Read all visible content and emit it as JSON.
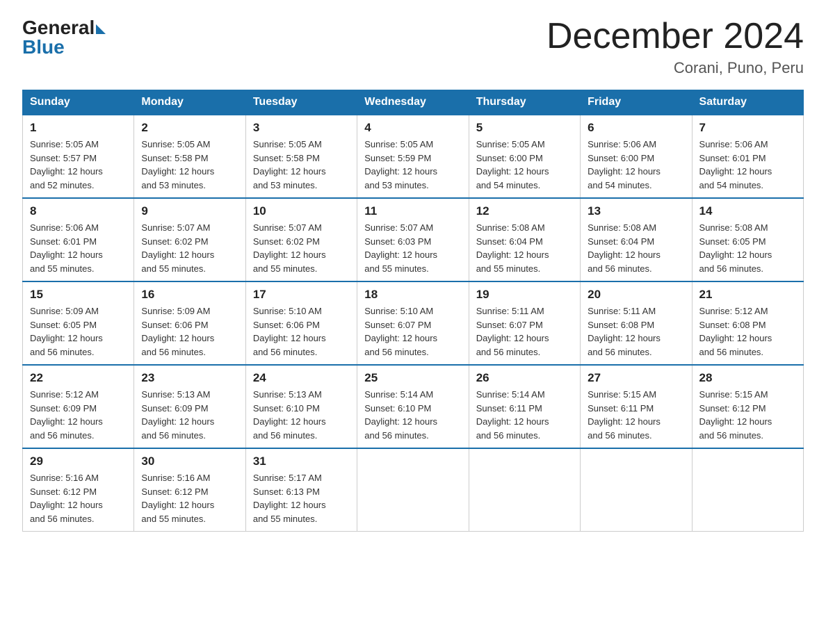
{
  "logo": {
    "general": "General",
    "blue": "Blue"
  },
  "header": {
    "month": "December 2024",
    "location": "Corani, Puno, Peru"
  },
  "days_of_week": [
    "Sunday",
    "Monday",
    "Tuesday",
    "Wednesday",
    "Thursday",
    "Friday",
    "Saturday"
  ],
  "weeks": [
    [
      {
        "num": "1",
        "sunrise": "5:05 AM",
        "sunset": "5:57 PM",
        "daylight": "12 hours and 52 minutes."
      },
      {
        "num": "2",
        "sunrise": "5:05 AM",
        "sunset": "5:58 PM",
        "daylight": "12 hours and 53 minutes."
      },
      {
        "num": "3",
        "sunrise": "5:05 AM",
        "sunset": "5:58 PM",
        "daylight": "12 hours and 53 minutes."
      },
      {
        "num": "4",
        "sunrise": "5:05 AM",
        "sunset": "5:59 PM",
        "daylight": "12 hours and 53 minutes."
      },
      {
        "num": "5",
        "sunrise": "5:05 AM",
        "sunset": "6:00 PM",
        "daylight": "12 hours and 54 minutes."
      },
      {
        "num": "6",
        "sunrise": "5:06 AM",
        "sunset": "6:00 PM",
        "daylight": "12 hours and 54 minutes."
      },
      {
        "num": "7",
        "sunrise": "5:06 AM",
        "sunset": "6:01 PM",
        "daylight": "12 hours and 54 minutes."
      }
    ],
    [
      {
        "num": "8",
        "sunrise": "5:06 AM",
        "sunset": "6:01 PM",
        "daylight": "12 hours and 55 minutes."
      },
      {
        "num": "9",
        "sunrise": "5:07 AM",
        "sunset": "6:02 PM",
        "daylight": "12 hours and 55 minutes."
      },
      {
        "num": "10",
        "sunrise": "5:07 AM",
        "sunset": "6:02 PM",
        "daylight": "12 hours and 55 minutes."
      },
      {
        "num": "11",
        "sunrise": "5:07 AM",
        "sunset": "6:03 PM",
        "daylight": "12 hours and 55 minutes."
      },
      {
        "num": "12",
        "sunrise": "5:08 AM",
        "sunset": "6:04 PM",
        "daylight": "12 hours and 55 minutes."
      },
      {
        "num": "13",
        "sunrise": "5:08 AM",
        "sunset": "6:04 PM",
        "daylight": "12 hours and 56 minutes."
      },
      {
        "num": "14",
        "sunrise": "5:08 AM",
        "sunset": "6:05 PM",
        "daylight": "12 hours and 56 minutes."
      }
    ],
    [
      {
        "num": "15",
        "sunrise": "5:09 AM",
        "sunset": "6:05 PM",
        "daylight": "12 hours and 56 minutes."
      },
      {
        "num": "16",
        "sunrise": "5:09 AM",
        "sunset": "6:06 PM",
        "daylight": "12 hours and 56 minutes."
      },
      {
        "num": "17",
        "sunrise": "5:10 AM",
        "sunset": "6:06 PM",
        "daylight": "12 hours and 56 minutes."
      },
      {
        "num": "18",
        "sunrise": "5:10 AM",
        "sunset": "6:07 PM",
        "daylight": "12 hours and 56 minutes."
      },
      {
        "num": "19",
        "sunrise": "5:11 AM",
        "sunset": "6:07 PM",
        "daylight": "12 hours and 56 minutes."
      },
      {
        "num": "20",
        "sunrise": "5:11 AM",
        "sunset": "6:08 PM",
        "daylight": "12 hours and 56 minutes."
      },
      {
        "num": "21",
        "sunrise": "5:12 AM",
        "sunset": "6:08 PM",
        "daylight": "12 hours and 56 minutes."
      }
    ],
    [
      {
        "num": "22",
        "sunrise": "5:12 AM",
        "sunset": "6:09 PM",
        "daylight": "12 hours and 56 minutes."
      },
      {
        "num": "23",
        "sunrise": "5:13 AM",
        "sunset": "6:09 PM",
        "daylight": "12 hours and 56 minutes."
      },
      {
        "num": "24",
        "sunrise": "5:13 AM",
        "sunset": "6:10 PM",
        "daylight": "12 hours and 56 minutes."
      },
      {
        "num": "25",
        "sunrise": "5:14 AM",
        "sunset": "6:10 PM",
        "daylight": "12 hours and 56 minutes."
      },
      {
        "num": "26",
        "sunrise": "5:14 AM",
        "sunset": "6:11 PM",
        "daylight": "12 hours and 56 minutes."
      },
      {
        "num": "27",
        "sunrise": "5:15 AM",
        "sunset": "6:11 PM",
        "daylight": "12 hours and 56 minutes."
      },
      {
        "num": "28",
        "sunrise": "5:15 AM",
        "sunset": "6:12 PM",
        "daylight": "12 hours and 56 minutes."
      }
    ],
    [
      {
        "num": "29",
        "sunrise": "5:16 AM",
        "sunset": "6:12 PM",
        "daylight": "12 hours and 56 minutes."
      },
      {
        "num": "30",
        "sunrise": "5:16 AM",
        "sunset": "6:12 PM",
        "daylight": "12 hours and 55 minutes."
      },
      {
        "num": "31",
        "sunrise": "5:17 AM",
        "sunset": "6:13 PM",
        "daylight": "12 hours and 55 minutes."
      },
      null,
      null,
      null,
      null
    ]
  ],
  "labels": {
    "sunrise": "Sunrise:",
    "sunset": "Sunset:",
    "daylight": "Daylight:"
  }
}
